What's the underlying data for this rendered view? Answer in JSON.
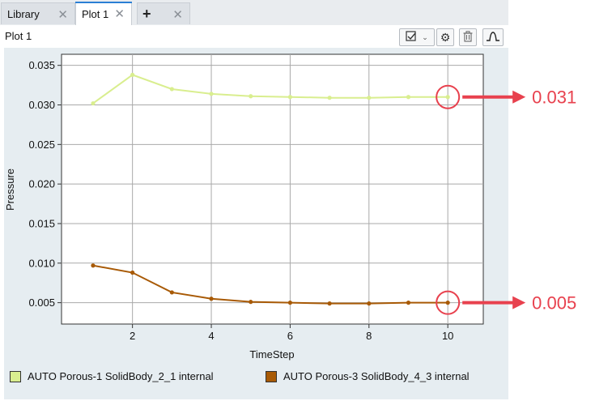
{
  "tabs": [
    {
      "label": "Library",
      "active": false
    },
    {
      "label": "Plot 1",
      "active": true
    },
    {
      "label": "+",
      "active": false
    }
  ],
  "plot_header": {
    "title": "Plot 1",
    "toolbar_icons": [
      "checkbox-menu-icon",
      "chevron-down-icon",
      "gear-icon",
      "trash-icon",
      "step-curve-icon"
    ]
  },
  "callouts": [
    {
      "text": "0.031",
      "series_index": 0,
      "point_index": 9,
      "color": "#e8414e"
    },
    {
      "text": "0.005",
      "series_index": 1,
      "point_index": 9,
      "color": "#e8414e"
    }
  ],
  "chart_data": {
    "type": "line",
    "title": "",
    "xlabel": "TimeStep",
    "ylabel": "Pressure",
    "xlim": [
      0.2,
      10.9
    ],
    "ylim": [
      0.0023,
      0.0364
    ],
    "xticks": [
      2,
      4,
      6,
      8,
      10
    ],
    "yticks": [
      0.005,
      0.01,
      0.015,
      0.02,
      0.025,
      0.03,
      0.035
    ],
    "ytick_labels": [
      "0.005",
      "0.010",
      "0.015",
      "0.020",
      "0.025",
      "0.030",
      "0.035"
    ],
    "grid": true,
    "legend_position": "bottom",
    "x": [
      1,
      2,
      3,
      4,
      5,
      6,
      7,
      8,
      9,
      10
    ],
    "series": [
      {
        "name": "AUTO Porous-1 SolidBody_2_1 internal",
        "color": "#d9ee8f",
        "values": [
          0.0302,
          0.0338,
          0.032,
          0.0314,
          0.0311,
          0.031,
          0.0309,
          0.0309,
          0.031,
          0.031
        ]
      },
      {
        "name": "AUTO Porous-3 SolidBody_4_3 internal",
        "color": "#a85a06",
        "values": [
          0.0097,
          0.0088,
          0.0063,
          0.0055,
          0.0051,
          0.005,
          0.0049,
          0.0049,
          0.005,
          0.005
        ]
      }
    ]
  }
}
